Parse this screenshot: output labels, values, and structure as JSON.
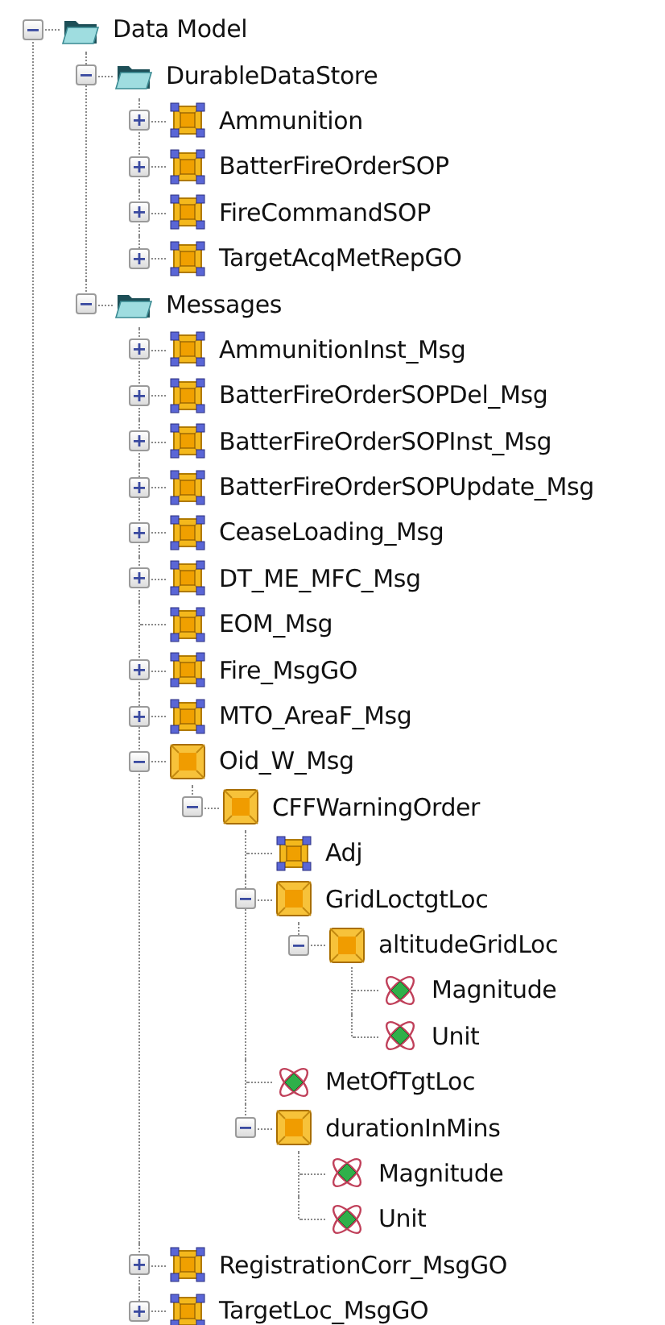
{
  "tree": [
    {
      "label": "Data Model",
      "kind": "folder",
      "expanded": true,
      "children": [
        {
          "label": "DurableDataStore",
          "kind": "folder",
          "expanded": true,
          "children": [
            {
              "label": "Ammunition",
              "kind": "class",
              "expanded": false
            },
            {
              "label": "BatterFireOrderSOP",
              "kind": "class",
              "expanded": false
            },
            {
              "label": "FireCommandSOP",
              "kind": "class",
              "expanded": false
            },
            {
              "label": "TargetAcqMetRepGO",
              "kind": "class",
              "expanded": false
            }
          ]
        },
        {
          "label": "Messages",
          "kind": "folder",
          "expanded": true,
          "children": [
            {
              "label": "AmmunitionInst_Msg",
              "kind": "class",
              "expanded": false
            },
            {
              "label": "BatterFireOrderSOPDel_Msg",
              "kind": "class",
              "expanded": false
            },
            {
              "label": "BatterFireOrderSOPInst_Msg",
              "kind": "class",
              "expanded": false
            },
            {
              "label": "BatterFireOrderSOPUpdate_Msg",
              "kind": "class",
              "expanded": false
            },
            {
              "label": "CeaseLoading_Msg",
              "kind": "class",
              "expanded": false
            },
            {
              "label": "DT_ME_MFC_Msg",
              "kind": "class",
              "expanded": false
            },
            {
              "label": "EOM_Msg",
              "kind": "class"
            },
            {
              "label": "Fire_MsgGO",
              "kind": "class",
              "expanded": false
            },
            {
              "label": "MTO_AreaF_Msg",
              "kind": "class",
              "expanded": false
            },
            {
              "label": "Oid_W_Msg",
              "kind": "object",
              "expanded": true,
              "children": [
                {
                  "label": "CFFWarningOrder",
                  "kind": "object",
                  "expanded": true,
                  "children": [
                    {
                      "label": "Adj",
                      "kind": "class"
                    },
                    {
                      "label": "GridLoctgtLoc",
                      "kind": "object",
                      "expanded": true,
                      "children": [
                        {
                          "label": "altitudeGridLoc",
                          "kind": "object",
                          "expanded": true,
                          "children": [
                            {
                              "label": "Magnitude",
                              "kind": "attribute"
                            },
                            {
                              "label": "Unit",
                              "kind": "attribute"
                            }
                          ]
                        }
                      ]
                    },
                    {
                      "label": "MetOfTgtLoc",
                      "kind": "attribute"
                    },
                    {
                      "label": "durationInMins",
                      "kind": "object",
                      "expanded": true,
                      "children": [
                        {
                          "label": "Magnitude",
                          "kind": "attribute"
                        },
                        {
                          "label": "Unit",
                          "kind": "attribute"
                        }
                      ]
                    }
                  ]
                }
              ]
            },
            {
              "label": "RegistrationCorr_MsgGO",
              "kind": "class",
              "expanded": false
            },
            {
              "label": "TargetLoc_MsgGO",
              "kind": "class",
              "expanded": false
            }
          ]
        }
      ]
    }
  ]
}
